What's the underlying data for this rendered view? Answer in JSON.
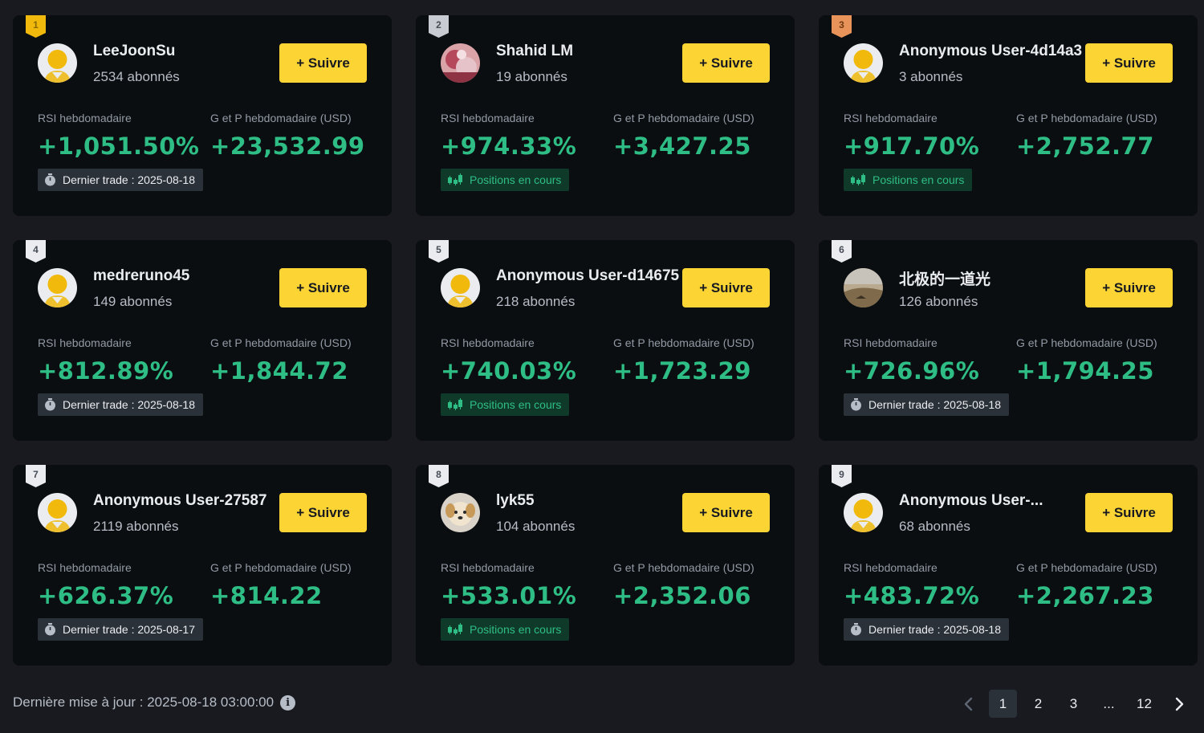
{
  "labels": {
    "rsi": "RSI hebdomadaire",
    "pnl": "G et P hebdomadaire (USD)",
    "follow": "+ Suivre",
    "open_positions": "Positions en cours"
  },
  "cards": [
    {
      "rank": "1",
      "rank_style": "gold",
      "name": "LeeJoonSu",
      "followers": "2534 abonnés",
      "rsi": "+1,051.50%",
      "pnl": "+23,532.99",
      "tag_type": "last",
      "tag_text": "Dernier trade : 2025-08-18",
      "avatar": "default"
    },
    {
      "rank": "2",
      "rank_style": "silver",
      "name": "Shahid LM",
      "followers": "19 abonnés",
      "rsi": "+974.33%",
      "pnl": "+3,427.25",
      "tag_type": "open",
      "tag_text": "Positions en cours",
      "avatar": "photo-pink"
    },
    {
      "rank": "3",
      "rank_style": "bronze",
      "name": "Anonymous User-4d14a3",
      "followers": "3 abonnés",
      "rsi": "+917.70%",
      "pnl": "+2,752.77",
      "tag_type": "open",
      "tag_text": "Positions en cours",
      "avatar": "default"
    },
    {
      "rank": "4",
      "rank_style": "plain",
      "name": "medreruno45",
      "followers": "149 abonnés",
      "rsi": "+812.89%",
      "pnl": "+1,844.72",
      "tag_type": "last",
      "tag_text": "Dernier trade : 2025-08-18",
      "avatar": "default"
    },
    {
      "rank": "5",
      "rank_style": "plain",
      "name": "Anonymous User-d14675",
      "followers": "218 abonnés",
      "rsi": "+740.03%",
      "pnl": "+1,723.29",
      "tag_type": "open",
      "tag_text": "Positions en cours",
      "avatar": "default"
    },
    {
      "rank": "6",
      "rank_style": "plain",
      "name": "北极的一道光",
      "followers": "126 abonnés",
      "rsi": "+726.96%",
      "pnl": "+1,794.25",
      "tag_type": "last",
      "tag_text": "Dernier trade : 2025-08-18",
      "avatar": "photo-landscape"
    },
    {
      "rank": "7",
      "rank_style": "plain",
      "name": "Anonymous User-27587",
      "followers": "2119 abonnés",
      "rsi": "+626.37%",
      "pnl": "+814.22",
      "tag_type": "last",
      "tag_text": "Dernier trade : 2025-08-17",
      "avatar": "default"
    },
    {
      "rank": "8",
      "rank_style": "plain",
      "name": "lyk55",
      "followers": "104 abonnés",
      "rsi": "+533.01%",
      "pnl": "+2,352.06",
      "tag_type": "open",
      "tag_text": "Positions en cours",
      "avatar": "photo-dog"
    },
    {
      "rank": "9",
      "rank_style": "plain",
      "name": "Anonymous User-...",
      "followers": "68 abonnés",
      "rsi": "+483.72%",
      "pnl": "+2,267.23",
      "tag_type": "last",
      "tag_text": "Dernier trade : 2025-08-18",
      "avatar": "default"
    }
  ],
  "footer": {
    "last_update": "Dernière mise à jour : 2025-08-18 03:00:00"
  },
  "pagination": {
    "pages": [
      "1",
      "2",
      "3",
      "...",
      "12"
    ],
    "current": "1"
  },
  "colors": {
    "accent": "#fcd535",
    "positive": "#2ebd85",
    "card_bg": "#0b0e11",
    "page_bg": "#181a20"
  }
}
